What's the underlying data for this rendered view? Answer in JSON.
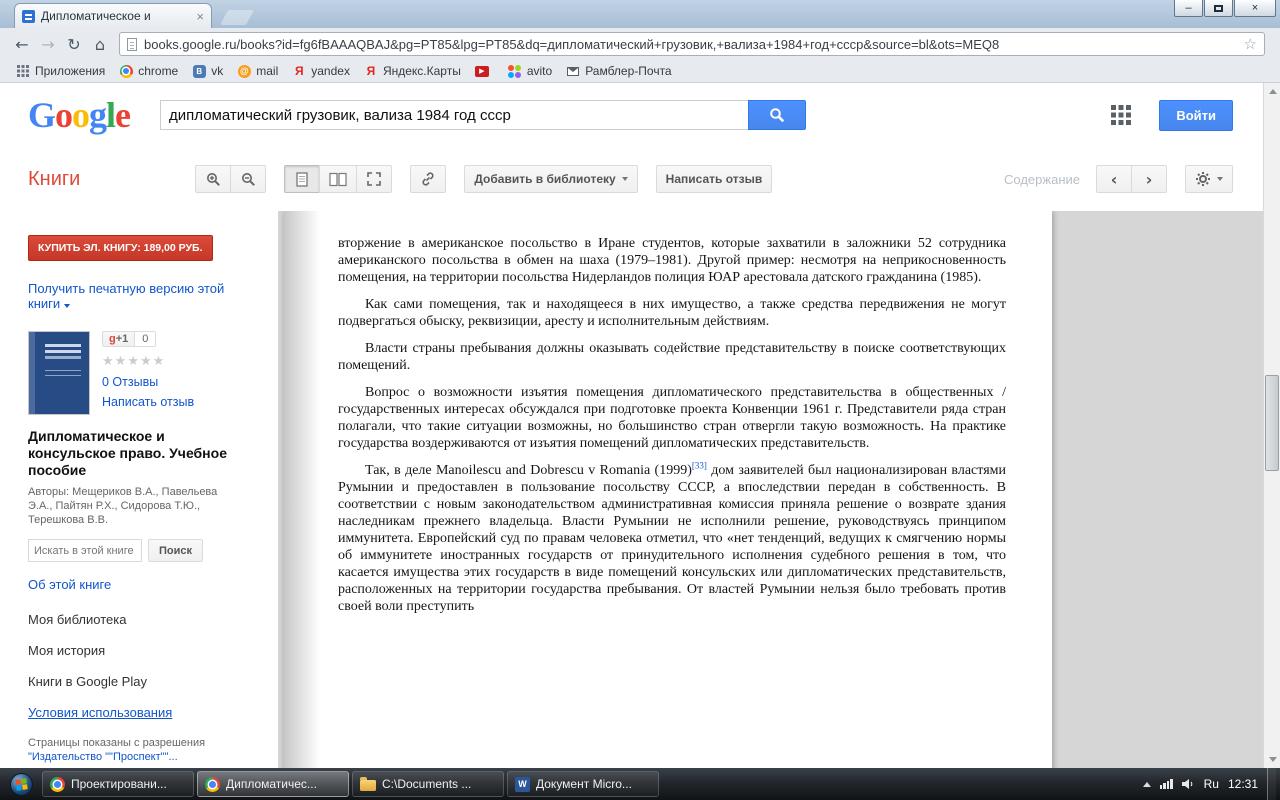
{
  "icons": {
    "close": "×",
    "minimize": "–",
    "back": "←",
    "forward": "→",
    "refresh": "↻",
    "home": "⌂",
    "star_outline": "☆",
    "star": "★",
    "chevron_left": "‹",
    "chevron_right": "›",
    "play": "▶",
    "at": "@",
    "vk": "В",
    "yandex": "Я",
    "word": "W"
  },
  "colors": {
    "accent_blue": "#4d90fe",
    "buy_red": "#dd4b39",
    "link_blue": "#1155cc",
    "books_red": "#dd4b39"
  },
  "browser": {
    "tab_title": "Дипломатическое и",
    "url": "books.google.ru/books?id=fg6fBAAAQBAJ&pg=PT85&lpg=PT85&dq=дипломатический+грузовик,+вализа+1984+год+ссср&source=bl&ots=MEQ8",
    "bookmarks": [
      {
        "label": "Приложения"
      },
      {
        "label": "chrome"
      },
      {
        "label": "vk"
      },
      {
        "label": "mail"
      },
      {
        "label": "yandex"
      },
      {
        "label": "Яндекс.Карты"
      },
      {
        "label": ""
      },
      {
        "label": "avito"
      },
      {
        "label": "Рамблер-Почта"
      }
    ]
  },
  "header": {
    "logo_letters": [
      {
        "c": "G"
      },
      {
        "c": "o"
      },
      {
        "c": "o"
      },
      {
        "c": "g"
      },
      {
        "c": "l"
      },
      {
        "c": "e"
      }
    ],
    "search_value": "дипломатический грузовик, вализа 1984 год ссср",
    "signin": "Войти"
  },
  "toolbar": {
    "section": "Книги",
    "add_to_library": "Добавить в библиотеку",
    "write_review": "Написать отзыв",
    "contents": "Содержание"
  },
  "sidebar": {
    "buy": "КУПИТЬ ЭЛ. КНИГУ: 189,00 РУБ.",
    "print_version": "Получить печатную версию этой книги",
    "gplus_g": "g",
    "gplus_plus1": "+1",
    "gplus_count": "0",
    "reviews": "0 Отзывы",
    "write_review": "Написать отзыв",
    "title": "Дипломатическое и консульское право. Учебное пособие",
    "authors": "Авторы: Мещериков В.А., Павельева Э.А., Пайтян Р.Х., Сидорова Т.Ю., Терешкова В.В.",
    "search_placeholder": "Искать в этой книге",
    "search_btn": "Поиск",
    "about": "Об этой книге",
    "nav": [
      {
        "label": "Моя библиотека"
      },
      {
        "label": "Моя история"
      },
      {
        "label": "Книги в Google Play"
      },
      {
        "label": "Условия использования"
      }
    ],
    "permission": "Страницы показаны с разрешения",
    "publisher": "\"Издательство \"\"Проспект\"\"..."
  },
  "page_text": {
    "p1": "вторжение в американское посольство в Иране студентов, которые захватили в заложники 52 сотрудника американского посольства в обмен на шаха (1979–1981). Другой пример: несмотря на неприкосновенность помещения, на территории посольства Нидерландов полиция ЮАР арестовала датского гражданина (1985).",
    "p2": "Как сами помещения, так и находящееся в них имущество, а также средства передвижения не могут подвергаться обыску, реквизиции, аресту и исполнительным действиям.",
    "p3": "Власти страны пребывания должны оказывать содействие представительству в поиске соответствующих помещений.",
    "p4": "Вопрос о возможности изъятия помещения дипломатического представительства в общественных / государственных интересах обсуждался при подготовке проекта Конвенции 1961 г. Представители ряда стран полагали, что такие ситуации возможны, но большинство стран отвергли такую возможность. На практике государства воздерживаются от изъятия помещений дипломатических представительств.",
    "p5_before": "Так, в деле Manoilescu and Dobrescu v Romania (1999)",
    "p5_note": "[33]",
    "p5_after": " дом заявителей был национализирован властями Румынии и предоставлен в пользование посольству СССР, а впоследствии передан в собственность. В соответствии с новым законодательством административная комиссия приняла решение о возврате здания наследникам прежнего владельца. Власти Румынии не исполнили решение, руководствуясь принципом иммунитета. Европейский суд по правам человека отметил, что «нет тенденций, ведущих к смягчению нормы об иммунитете иностранных государств от принудительного исполнения судебного решения в том, что касается имущества этих государств в виде помещений консульских или дипломатических представительств, расположенных на территории государства пребывания. От властей Румынии нельзя было требовать против своей воли преступить"
  },
  "taskbar": {
    "items": [
      {
        "label": "Проектировани..."
      },
      {
        "label": "Дипломатичес..."
      },
      {
        "label": "C:\\Documents ..."
      },
      {
        "label": "Документ Micro..."
      }
    ],
    "lang": "Ru",
    "time": "12:31"
  }
}
